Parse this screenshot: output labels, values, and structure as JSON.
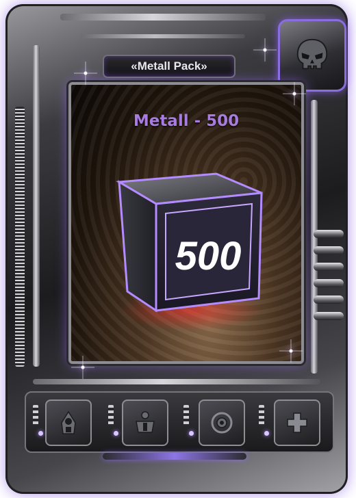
{
  "card": {
    "pack_name": "«Metall Pack»",
    "title": "Metall - 500",
    "amount": "500",
    "emblem_icon": "skull-icon",
    "accent_color": "#a77be0",
    "glow_color": "#8a6ee0"
  },
  "slots": [
    {
      "icon": "hooded-figure-icon"
    },
    {
      "icon": "armor-torso-icon"
    },
    {
      "icon": "eye-rune-icon"
    },
    {
      "icon": "plus-cross-icon"
    }
  ]
}
